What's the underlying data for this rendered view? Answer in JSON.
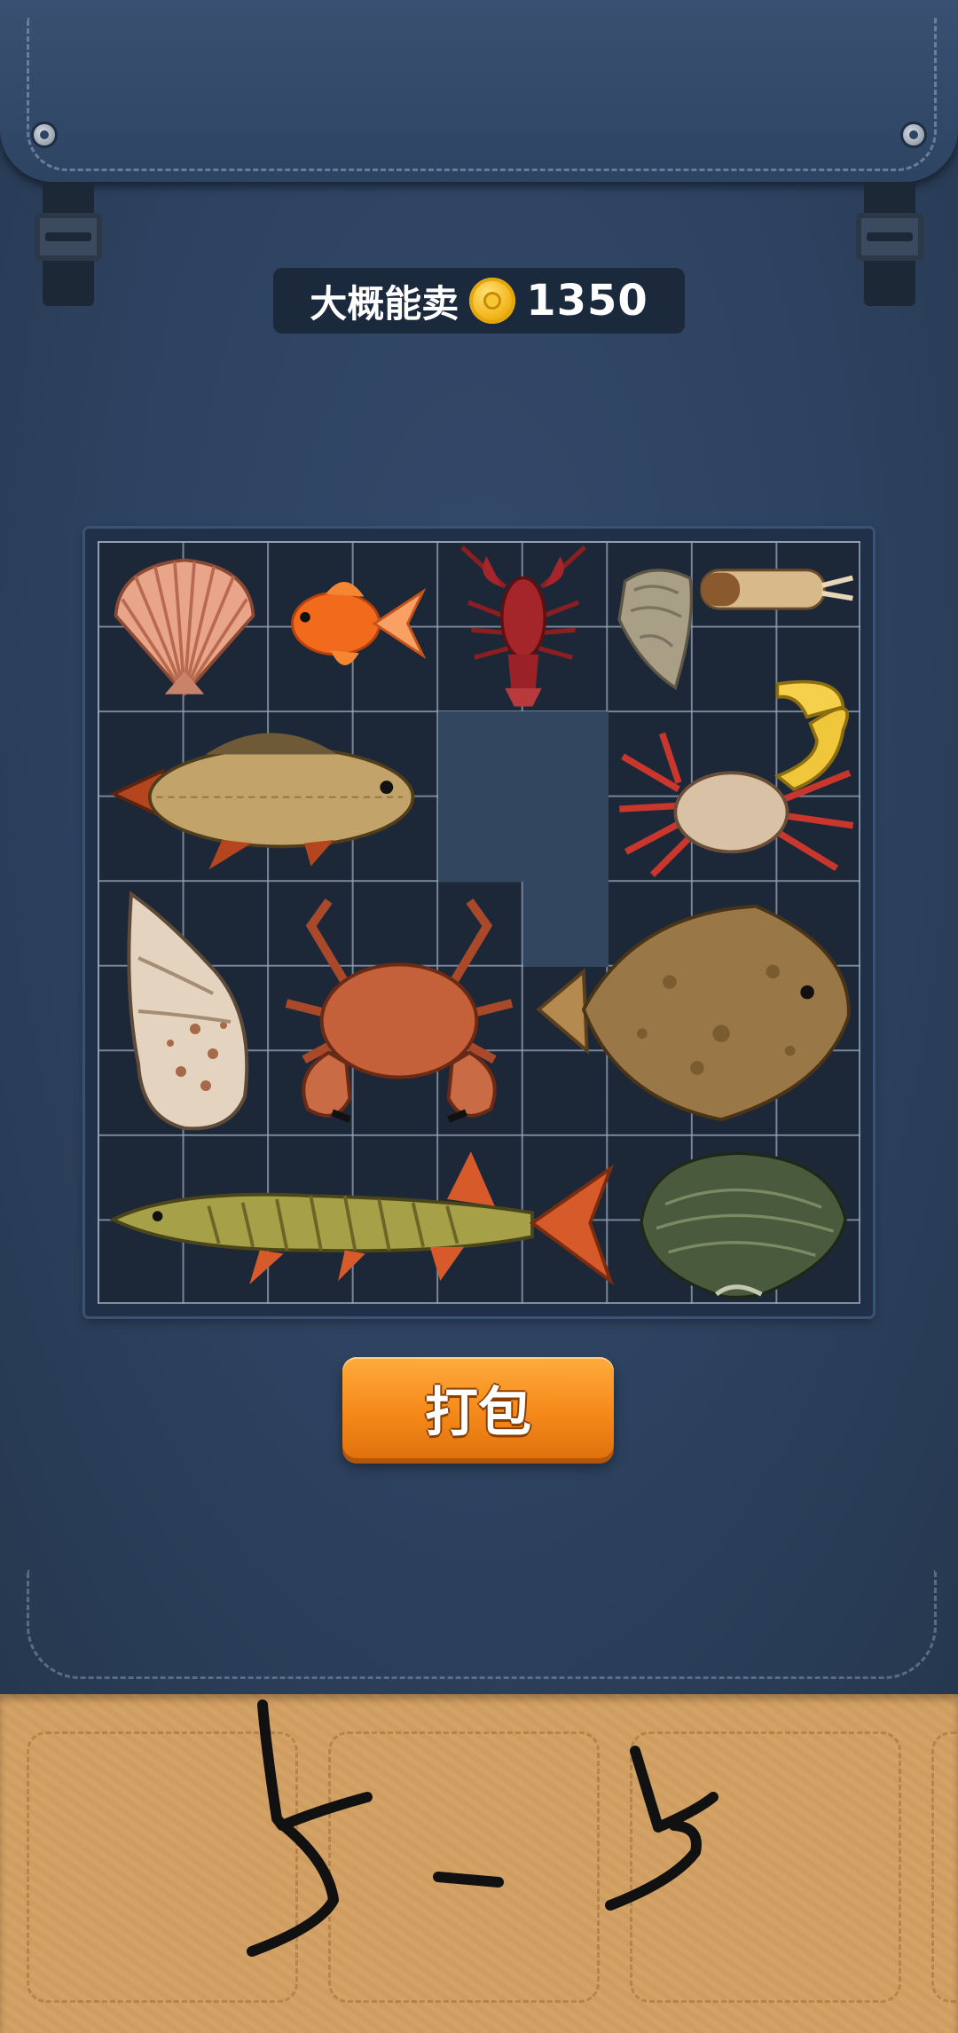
{
  "price": {
    "label": "大概能卖",
    "currency_icon": "gold-coin-icon",
    "value": "1350"
  },
  "grid": {
    "columns": 9,
    "rows": 9,
    "items": [
      {
        "name": "scallop"
      },
      {
        "name": "goldfish"
      },
      {
        "name": "crayfish"
      },
      {
        "name": "oyster"
      },
      {
        "name": "razor-clam"
      },
      {
        "name": "carp"
      },
      {
        "name": "fiddler-crab"
      },
      {
        "name": "whelk-shell"
      },
      {
        "name": "brown-crab"
      },
      {
        "name": "flounder"
      },
      {
        "name": "pike"
      },
      {
        "name": "mussel"
      }
    ]
  },
  "buttons": {
    "pack_label": "打包"
  },
  "tray": {
    "slot_count": 4
  },
  "colors": {
    "bag": "#2d4260",
    "tray": "#d3a266",
    "button": "#f58a1a",
    "coin": "#f2b417"
  }
}
